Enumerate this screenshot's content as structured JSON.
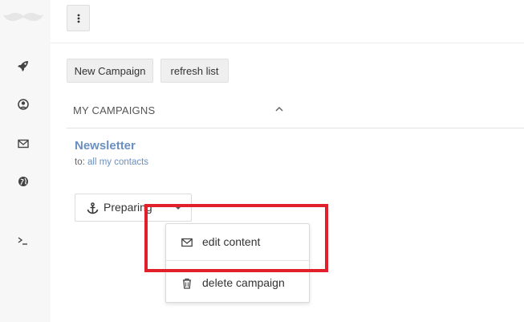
{
  "sidebar": {
    "logo": "mustache-logo",
    "items": [
      {
        "icon": "rocket-icon"
      },
      {
        "icon": "user-circle-icon"
      },
      {
        "icon": "envelope-icon"
      },
      {
        "icon": "globe-icon"
      },
      {
        "icon": "terminal-icon"
      }
    ]
  },
  "topbar": {
    "menu_icon": "vertical-ellipsis-icon"
  },
  "toolbar": {
    "new_campaign_label": "New Campaign",
    "refresh_label": "refresh list"
  },
  "campaigns": {
    "section_title": "MY CAMPAIGNS",
    "items": [
      {
        "name": "Newsletter",
        "to_prefix": "to:",
        "to_value": "all my contacts",
        "status": "Preparing"
      }
    ]
  },
  "dropdown": {
    "items": [
      {
        "label": "edit content",
        "icon": "envelope-icon"
      },
      {
        "label": "delete campaign",
        "icon": "trash-icon"
      }
    ]
  },
  "colors": {
    "link": "#6a8fc1",
    "highlight": "#e0202a",
    "sidebar_bg": "#f7f7f7"
  }
}
